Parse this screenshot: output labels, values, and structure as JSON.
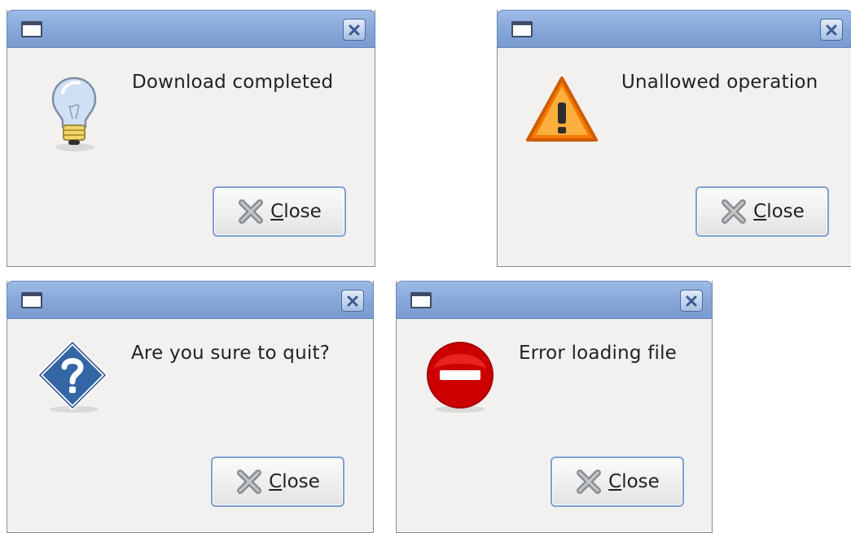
{
  "dialogs": [
    {
      "message": "Download completed",
      "icon": "lightbulb-icon",
      "button": {
        "mnemonic": "C",
        "rest": "lose"
      }
    },
    {
      "message": "Unallowed operation",
      "icon": "warning-icon",
      "button": {
        "mnemonic": "C",
        "rest": "lose"
      }
    },
    {
      "message": "Are you sure to quit?",
      "icon": "question-icon",
      "button": {
        "mnemonic": "C",
        "rest": "lose"
      }
    },
    {
      "message": "Error loading file",
      "icon": "error-icon",
      "button": {
        "mnemonic": "C",
        "rest": "lose"
      }
    }
  ],
  "colors": {
    "titlebar": "#86a6d8",
    "dialog_bg": "#f2f1f0",
    "warning": "#f57900",
    "error": "#cc0000",
    "question": "#3465a4"
  }
}
